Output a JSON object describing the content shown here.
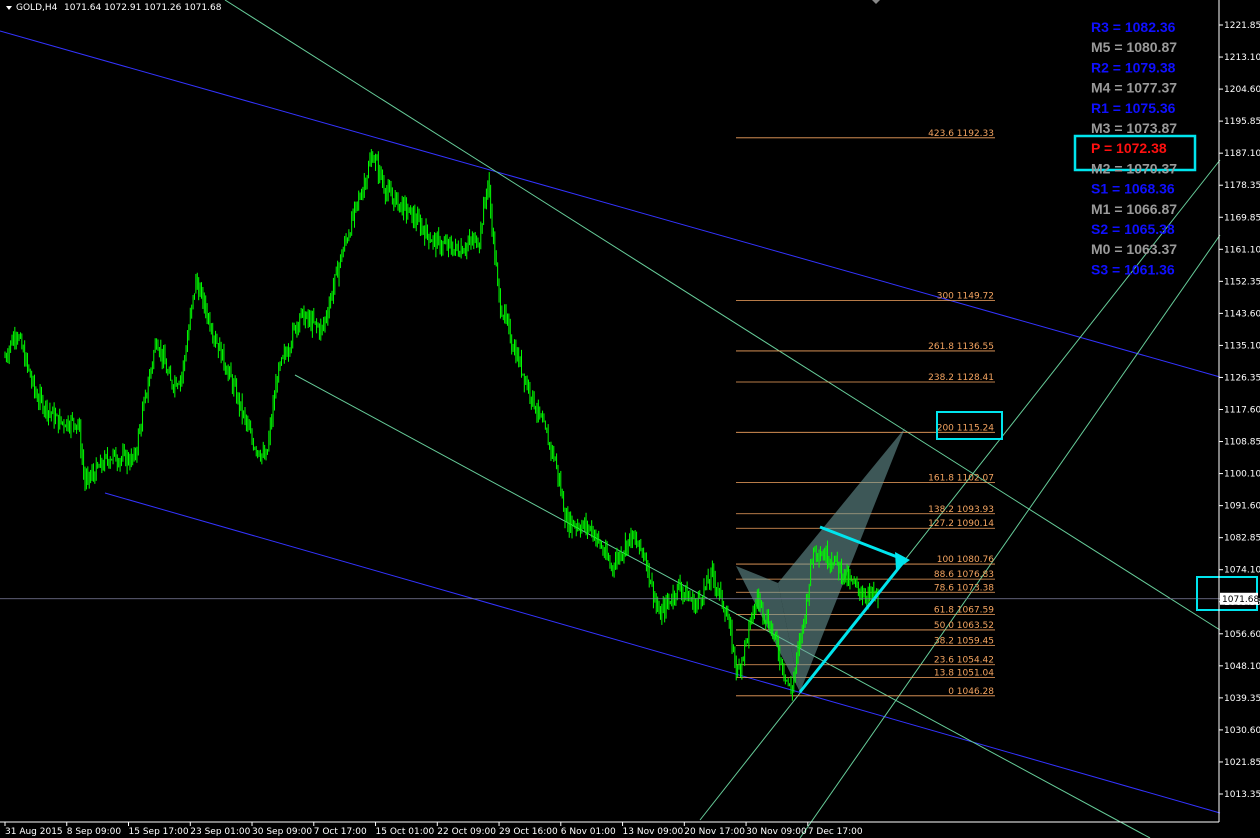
{
  "header": {
    "symbol": "GOLD,H4",
    "ohlc": "1071.64 1072.91 1071.26 1071.68"
  },
  "colors": {
    "background": "#000000",
    "candle": "#00ff00",
    "channel_blue": "#3333ff",
    "channel_green": "#66cc99",
    "fib": "#f4a460",
    "highlight": "#00e5ee",
    "pattern_fill": "#6f9f9f",
    "pivot_r": "#1010ff",
    "pivot_m": "#9a9a9a",
    "pivot_p": "#ff1010",
    "price_line": "#8080a0"
  },
  "current_price": {
    "label": "1071.68",
    "value": 1071.68
  },
  "chart_data": {
    "type": "candlestick",
    "ylim": [
      1013.35,
      1230.0
    ],
    "y_ticks": [
      "1221.85",
      "1213.10",
      "1204.60",
      "1195.85",
      "1187.10",
      "1178.35",
      "1169.85",
      "1161.10",
      "1152.35",
      "1143.60",
      "1135.10",
      "1126.35",
      "1117.60",
      "1108.85",
      "1100.10",
      "1091.60",
      "1082.85",
      "1074.10",
      "1065.35",
      "1056.60",
      "1048.10",
      "1039.35",
      "1030.60",
      "1021.85",
      "1013.35"
    ],
    "x_ticks": [
      "31 Aug 2015",
      "8 Sep 09:00",
      "15 Sep 17:00",
      "23 Sep 01:00",
      "30 Sep 09:00",
      "7 Oct 17:00",
      "15 Oct 01:00",
      "22 Oct 09:00",
      "29 Oct 16:00",
      "6 Nov 01:00",
      "13 Nov 09:00",
      "20 Nov 17:00",
      "30 Nov 09:00",
      "7 Dec 17:00"
    ],
    "x_tick_index": [
      0,
      44,
      88,
      132,
      176,
      220,
      264,
      308,
      352,
      396,
      440,
      484,
      528,
      572
    ],
    "price_path": [
      [
        0,
        1135
      ],
      [
        8,
        1142
      ],
      [
        22,
        1125
      ],
      [
        38,
        1118
      ],
      [
        52,
        1118
      ],
      [
        57,
        1102
      ],
      [
        75,
        1109
      ],
      [
        92,
        1108
      ],
      [
        108,
        1140
      ],
      [
        118,
        1128
      ],
      [
        126,
        1130
      ],
      [
        136,
        1155
      ],
      [
        148,
        1142
      ],
      [
        162,
        1128
      ],
      [
        176,
        1113
      ],
      [
        186,
        1108
      ],
      [
        194,
        1130
      ],
      [
        210,
        1146
      ],
      [
        226,
        1142
      ],
      [
        240,
        1162
      ],
      [
        252,
        1176
      ],
      [
        262,
        1188
      ],
      [
        272,
        1178
      ],
      [
        290,
        1172
      ],
      [
        306,
        1165
      ],
      [
        322,
        1163
      ],
      [
        338,
        1166
      ],
      [
        344,
        1181
      ],
      [
        352,
        1150
      ],
      [
        362,
        1138
      ],
      [
        378,
        1122
      ],
      [
        392,
        1108
      ],
      [
        400,
        1092
      ],
      [
        418,
        1090
      ],
      [
        432,
        1080
      ],
      [
        446,
        1088
      ],
      [
        456,
        1083
      ],
      [
        466,
        1067
      ],
      [
        480,
        1075
      ],
      [
        492,
        1070
      ],
      [
        504,
        1078
      ],
      [
        514,
        1068
      ],
      [
        522,
        1052
      ],
      [
        536,
        1072
      ],
      [
        546,
        1064
      ],
      [
        560,
        1047
      ],
      [
        570,
        1068
      ],
      [
        576,
        1085
      ],
      [
        590,
        1082
      ],
      [
        602,
        1076
      ],
      [
        612,
        1073
      ],
      [
        622,
        1072
      ]
    ],
    "fib_levels": [
      {
        "pct": "0",
        "value": 1046.28
      },
      {
        "pct": "13.8",
        "value": 1051.04
      },
      {
        "pct": "23.6",
        "value": 1054.42
      },
      {
        "pct": "38.2",
        "value": 1059.45
      },
      {
        "pct": "50.0",
        "value": 1063.52
      },
      {
        "pct": "61.8",
        "value": 1067.59
      },
      {
        "pct": "78.6",
        "value": 1073.38
      },
      {
        "pct": "88.6",
        "value": 1076.83
      },
      {
        "pct": "100",
        "value": 1080.76
      },
      {
        "pct": "127.2",
        "value": 1090.14
      },
      {
        "pct": "138.2",
        "value": 1093.93
      },
      {
        "pct": "161.8",
        "value": 1102.07
      },
      {
        "pct": "200",
        "value": 1115.24
      },
      {
        "pct": "238.2",
        "value": 1128.41
      },
      {
        "pct": "261.8",
        "value": 1136.55
      },
      {
        "pct": "300",
        "value": 1149.72
      },
      {
        "pct": "423.6",
        "value": 1192.33
      }
    ],
    "pivots": [
      {
        "label": "R3 = 1082.36",
        "kind": "r"
      },
      {
        "label": "M5 = 1080.87",
        "kind": "m"
      },
      {
        "label": "R2 = 1079.38",
        "kind": "r"
      },
      {
        "label": "M4 = 1077.37",
        "kind": "m"
      },
      {
        "label": "R1 = 1075.36",
        "kind": "r"
      },
      {
        "label": "M3 = 1073.87",
        "kind": "m"
      },
      {
        "label": "P  = 1072.38",
        "kind": "p"
      },
      {
        "label": "M2 = 1070.37",
        "kind": "m"
      },
      {
        "label": "S1 = 1068.36",
        "kind": "r"
      },
      {
        "label": "M1 = 1066.87",
        "kind": "m"
      },
      {
        "label": "S2 = 1065.38",
        "kind": "r"
      },
      {
        "label": "M0 = 1063.37",
        "kind": "m"
      },
      {
        "label": "S3 = 1061.36",
        "kind": "r"
      }
    ]
  }
}
